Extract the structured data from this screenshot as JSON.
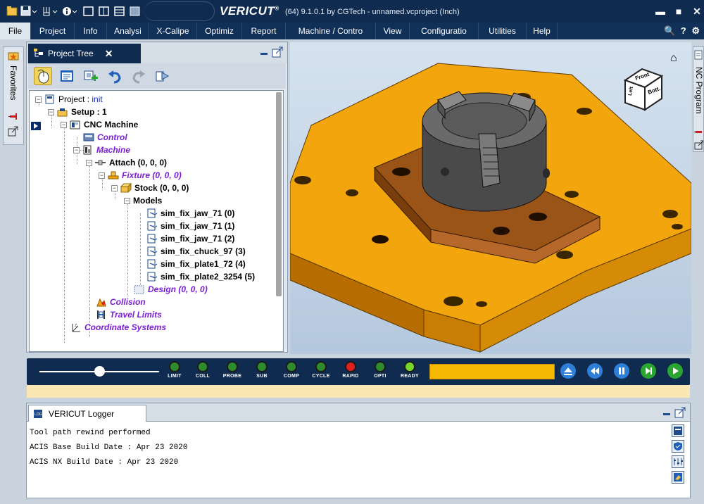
{
  "titlebar": {
    "app_name": "VERICUT",
    "trademark": "®",
    "info": "(64) 9.1.0.1 by CGTech - unnamed.vcproject (Inch)",
    "minimize": "▬",
    "maximize": "■",
    "close": "✕"
  },
  "menu": {
    "items": [
      "File",
      "Project",
      "Info",
      "Analysi",
      "X-Calipe",
      "Optimiz",
      "Report",
      "Machine / Contro",
      "View",
      "Configuratio",
      "Utilities",
      "Help"
    ],
    "right_icons": "🔍 ? ⚙"
  },
  "side_tabs": {
    "left": "Favorites",
    "right": "NC Program"
  },
  "project_tree": {
    "tab_label": "Project Tree",
    "close_label": "✕",
    "nodes": {
      "project_label": "Project : ",
      "project_name": "init",
      "setup": "Setup : 1",
      "cnc_machine": "CNC Machine",
      "control": "Control",
      "machine": "Machine",
      "attach": "Attach (0, 0, 0)",
      "fixture": "Fixture (0, 0, 0)",
      "stock": "Stock (0, 0, 0)",
      "models": "Models",
      "model_items": [
        "sim_fix_jaw_71 (0)",
        "sim_fix_jaw_71 (1)",
        "sim_fix_jaw_71 (2)",
        "sim_fix_chuck_97 (3)",
        "sim_fix_plate1_72 (4)",
        "sim_fix_plate2_3254 (5)"
      ],
      "design": "Design (0, 0, 0)",
      "collision": "Collision",
      "travel_limits": "Travel Limits",
      "coordinate_systems": "Coordinate Systems"
    }
  },
  "viewport": {
    "view_cube": {
      "front": "Front",
      "bottom": "Bott.",
      "left": "Left"
    },
    "home_icon": "⌂"
  },
  "controls": {
    "leds": [
      {
        "label": "LIMIT",
        "color": "#2e8b2e"
      },
      {
        "label": "COLL",
        "color": "#2e8b2e"
      },
      {
        "label": "PROBE",
        "color": "#2e8b2e"
      },
      {
        "label": "SUB",
        "color": "#2e8b2e"
      },
      {
        "label": "COMP",
        "color": "#2e8b2e"
      },
      {
        "label": "CYCLE",
        "color": "#2e8b2e"
      },
      {
        "label": "RAPID",
        "color": "#e02020"
      },
      {
        "label": "OPTI",
        "color": "#2e8b2e"
      },
      {
        "label": "READY",
        "color": "#7bd62a"
      }
    ],
    "progress_color": "#f6b800",
    "slider_position": 0.5
  },
  "logger": {
    "tab_label": "VERICUT Logger",
    "lines": [
      "Tool path rewind performed",
      "ACIS Base Build Date : Apr 23 2020",
      "ACIS NX Build Date : Apr 23 2020"
    ]
  },
  "colors": {
    "title_bg": "#0f2b4f",
    "fixture_orange": "#f2a50c",
    "plate_brown": "#9a5418",
    "chuck_gray": "#5d5d5d",
    "tree_purple": "#7a1fd6"
  }
}
